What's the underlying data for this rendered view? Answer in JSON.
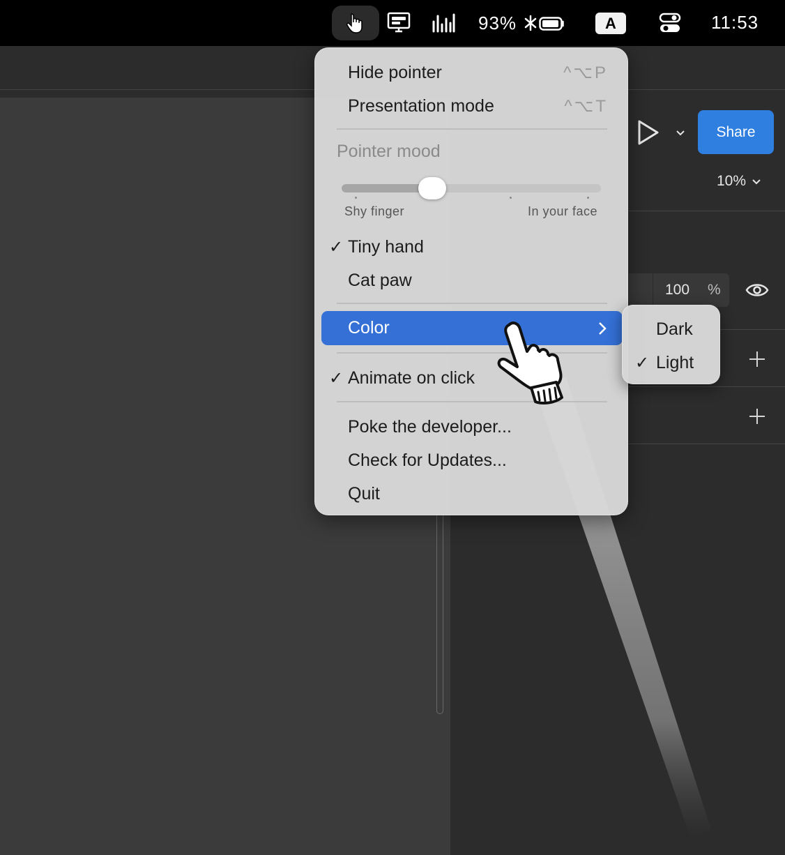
{
  "menubar": {
    "battery_percent": "93%",
    "input_source": "A",
    "clock": "11:53",
    "icons": [
      "pointer-hand-icon",
      "display-icon",
      "audio-bars-icon",
      "bluetooth-icon",
      "battery-icon",
      "control-center-icon"
    ]
  },
  "app": {
    "share_label": "Share",
    "zoom_level": "10%",
    "opacity_value": "100",
    "opacity_unit": "%",
    "accent_color": "#2f7fe0"
  },
  "menu": {
    "hide_pointer": {
      "label": "Hide pointer",
      "shortcut": "^⌥P"
    },
    "presentation_mode": {
      "label": "Presentation mode",
      "shortcut": "^⌥T"
    },
    "pointer_mood": {
      "label": "Pointer mood",
      "min_label": "Shy finger",
      "max_label": "In your face",
      "value": 0.35
    },
    "tiny_hand": {
      "label": "Tiny hand",
      "checked": true
    },
    "cat_paw": {
      "label": "Cat paw",
      "checked": false
    },
    "color": {
      "label": "Color",
      "highlighted": true
    },
    "animate_on_click": {
      "label": "Animate on click",
      "checked": true
    },
    "poke_developer": {
      "label": "Poke the developer..."
    },
    "check_updates": {
      "label": "Check for Updates..."
    },
    "quit": {
      "label": "Quit"
    },
    "check_mark": "✓",
    "highlight_color": "#3470d6"
  },
  "submenu": {
    "dark": {
      "label": "Dark",
      "checked": false
    },
    "light": {
      "label": "Light",
      "checked": true
    }
  }
}
